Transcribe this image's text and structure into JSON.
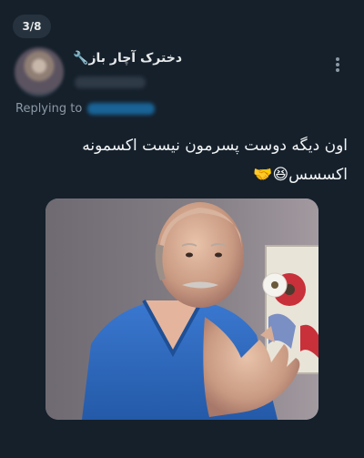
{
  "counter": "3/8",
  "author": {
    "display_name": "دخترک آچار باز",
    "name_mark": "🔧"
  },
  "reply": {
    "label": "Replying to"
  },
  "tweet": {
    "line1": "اون دیگه دوست پسرمون نیست اکسمونه",
    "line2": "اکسسس😆🤝"
  },
  "colors": {
    "background": "#15202b",
    "text": "#e7e9ea",
    "muted": "#8b98a5",
    "link": "#1d9bf0"
  },
  "icons": {
    "more": "more-vertical-icon"
  }
}
